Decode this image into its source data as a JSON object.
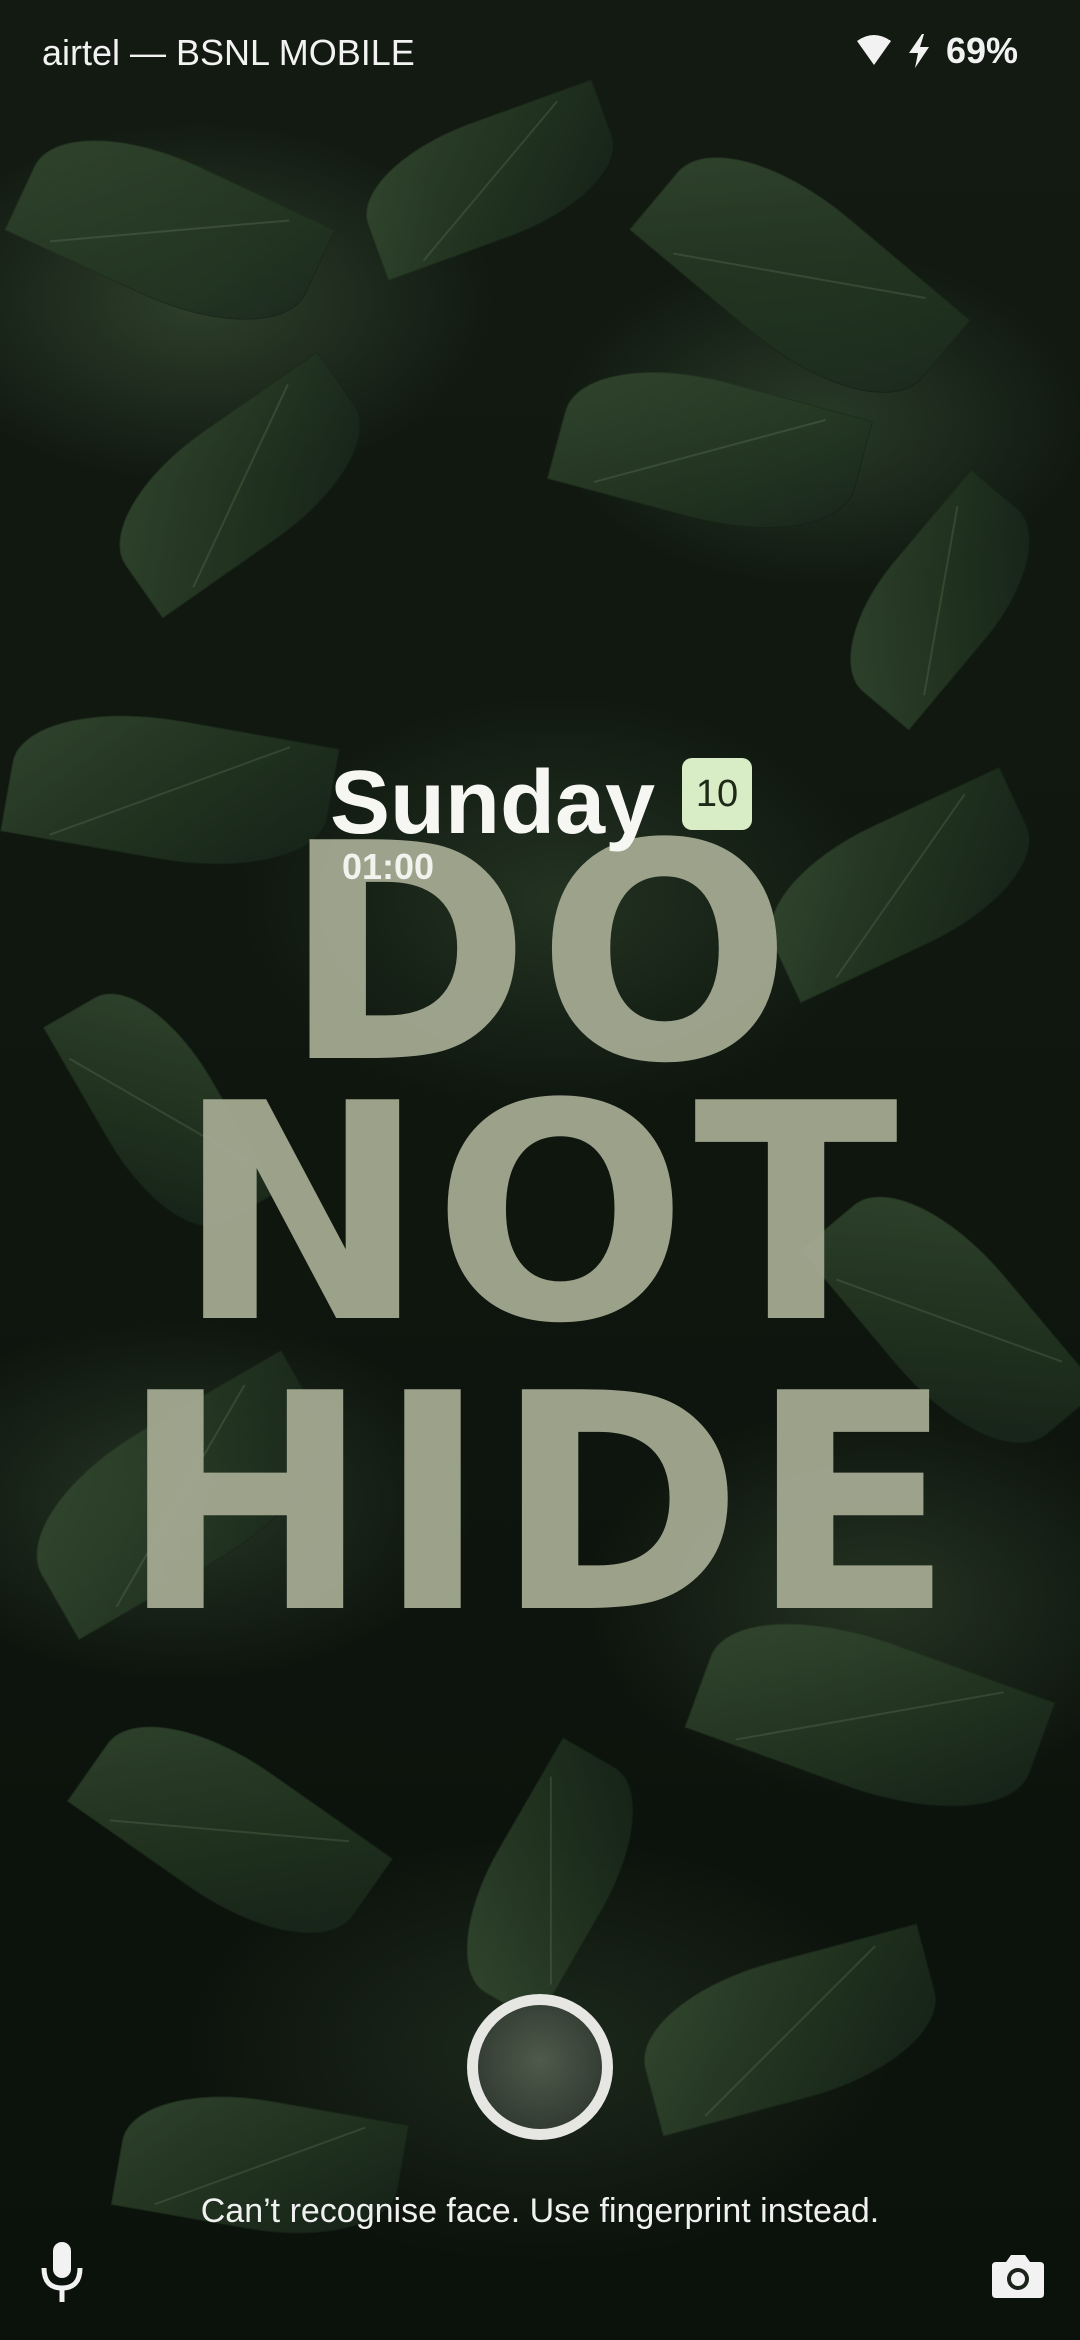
{
  "status_bar": {
    "carrier": "airtel — BSNL MOBILE",
    "battery": "69%",
    "icons": [
      "wifi-icon",
      "charging-bolt-icon"
    ]
  },
  "lockscreen": {
    "day": "Sunday",
    "date": "10",
    "time": "01:00"
  },
  "wallpaper": {
    "lines": [
      "DO",
      "NOT",
      "HIDE"
    ],
    "text_color": "#a7ac94"
  },
  "face_unlock": {
    "message": "Can’t recognise face. Use fingerprint instead."
  },
  "shortcuts": {
    "left_icon": "microphone-icon",
    "right_icon": "camera-icon"
  }
}
